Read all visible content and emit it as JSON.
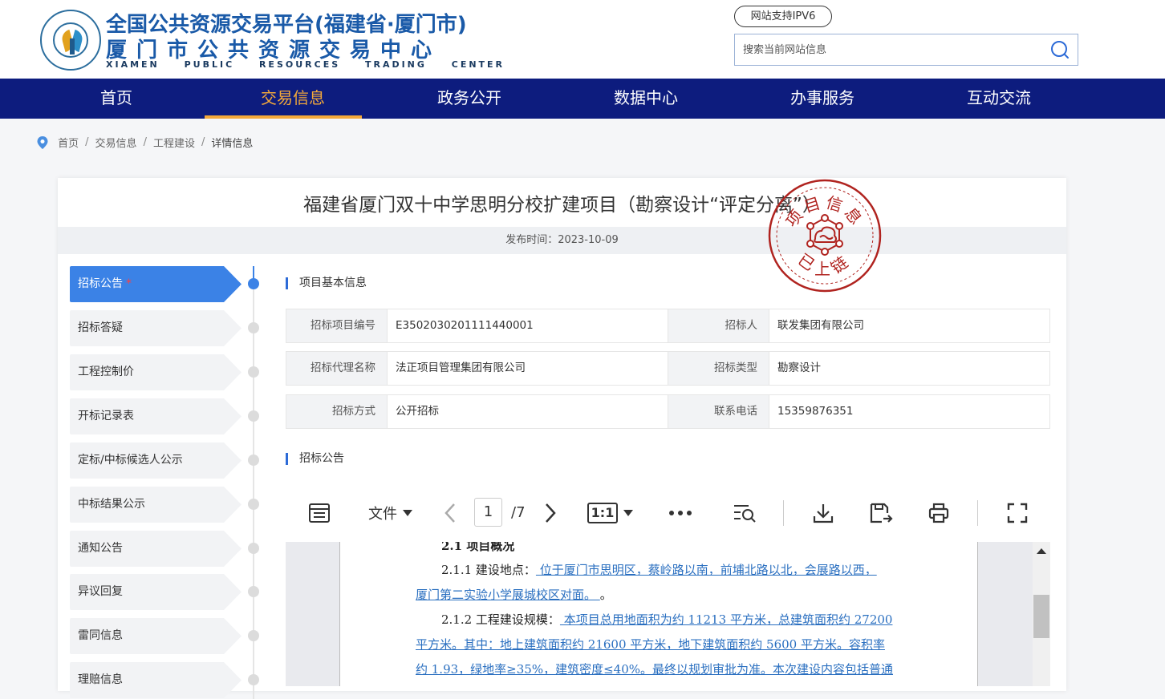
{
  "header": {
    "title_line1": "全国公共资源交易平台(福建省·厦门市)",
    "title_line2": "厦门市公共资源交易中心",
    "title_line3": "XIAMEN PUBLIC RESOURCES TRADING CENTER",
    "ipv6_badge": "网站支持IPV6",
    "search_placeholder": "搜索当前网站信息"
  },
  "nav": {
    "items": [
      {
        "label": "首页"
      },
      {
        "label": "交易信息"
      },
      {
        "label": "政务公开"
      },
      {
        "label": "数据中心"
      },
      {
        "label": "办事服务"
      },
      {
        "label": "互动交流"
      }
    ],
    "active_index": 1
  },
  "breadcrumb": [
    "首页",
    "交易信息",
    "工程建设",
    "详情信息"
  ],
  "page": {
    "title": "福建省厦门双十中学思明分校扩建项目（勘察设计“评定分离”）",
    "publish_label": "发布时间：",
    "publish_date": "2023-10-09",
    "stamp_top": "项目信息",
    "stamp_bottom": "已上链"
  },
  "sidebar": {
    "items": [
      {
        "label": "招标公告",
        "star": "*"
      },
      {
        "label": "招标答疑"
      },
      {
        "label": "工程控制价"
      },
      {
        "label": "开标记录表"
      },
      {
        "label": "定标/中标候选人公示"
      },
      {
        "label": "中标结果公示"
      },
      {
        "label": "通知公告"
      },
      {
        "label": "异议回复"
      },
      {
        "label": "雷同信息"
      },
      {
        "label": "理赔信息"
      }
    ],
    "active_index": 0
  },
  "basic_info": {
    "section_title": "项目基本信息",
    "rows": [
      [
        {
          "k": "招标项目编号",
          "v": "E3502030201111440001"
        },
        {
          "k": "招标人",
          "v": "联发集团有限公司"
        }
      ],
      [
        {
          "k": "招标代理名称",
          "v": "法正项目管理集团有限公司"
        },
        {
          "k": "招标类型",
          "v": "勘察设计"
        }
      ],
      [
        {
          "k": "招标方式",
          "v": "公开招标"
        },
        {
          "k": "联系电话",
          "v": "15359876351"
        }
      ]
    ]
  },
  "announcement": {
    "section_title": "招标公告"
  },
  "viewer": {
    "file_menu": "文件",
    "current_page": "1",
    "total_pages": "/7",
    "zoom": "1:1",
    "doc": {
      "heading": "2.1 项目概况",
      "l1_prefix": "2.1.1 建设地点：",
      "l1_value": " 位于厦门市思明区，蔡岭路以南，前埔北路以北，会展路以西，",
      "l2_value": "厦门第二实验小学展城校区对面。 ",
      "l2_suffix": "。",
      "l3_prefix": "2.1.2 工程建设规模：",
      "l3_value": " 本项目总用地面积为约 11213 平方米，总建筑面积约 27200",
      "l4_value": "平方米。其中：地上建筑面积约 21600 平方米，地下建筑面积约 5600 平方米。容积率",
      "l5_value": "约 1.93，绿地率≥35%，建筑密度≤40%。最终以规划审批为准。本次建设内容包括普通"
    }
  },
  "colors": {
    "nav_bg": "#0d1c7e",
    "nav_active": "#f4a93a",
    "side_active": "#3b82e6",
    "stamp": "#b0231f",
    "link": "#2a6fc0"
  }
}
